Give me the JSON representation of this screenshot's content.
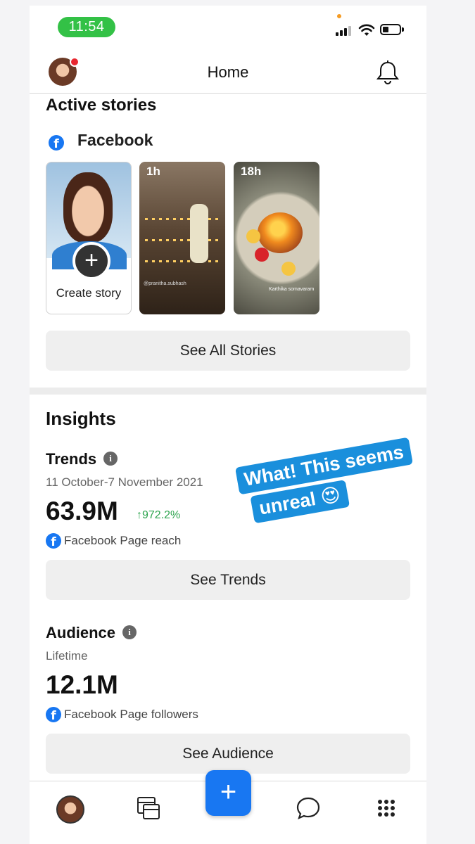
{
  "status_bar": {
    "time": "11:54"
  },
  "header": {
    "title": "Home"
  },
  "stories": {
    "section_title": "Active stories",
    "platform": "Facebook",
    "create_label": "Create story",
    "items": [
      {
        "age": "1h",
        "overlay_text": "@pranitha.subhash"
      },
      {
        "age": "18h",
        "overlay_text": "Karthika somavaram"
      }
    ],
    "see_all_label": "See All Stories"
  },
  "insights": {
    "title": "Insights",
    "trends": {
      "heading": "Trends",
      "date_range": "11 October-7 November 2021",
      "value": "63.9M",
      "change": "↑972.2%",
      "metric": "Facebook Page reach",
      "button": "See Trends"
    },
    "audience": {
      "heading": "Audience",
      "period": "Lifetime",
      "value": "12.1M",
      "metric": "Facebook Page followers",
      "button": "See Audience"
    }
  },
  "sticker": {
    "line1": "What! This seems",
    "line2": "unreal 😍"
  },
  "bottom_nav": {
    "items": [
      "profile",
      "pages",
      "create",
      "messages",
      "menu"
    ]
  },
  "colors": {
    "facebook_blue": "#1877f2",
    "positive_green": "#2ea44f",
    "sticker_blue": "#1a8fdc"
  }
}
